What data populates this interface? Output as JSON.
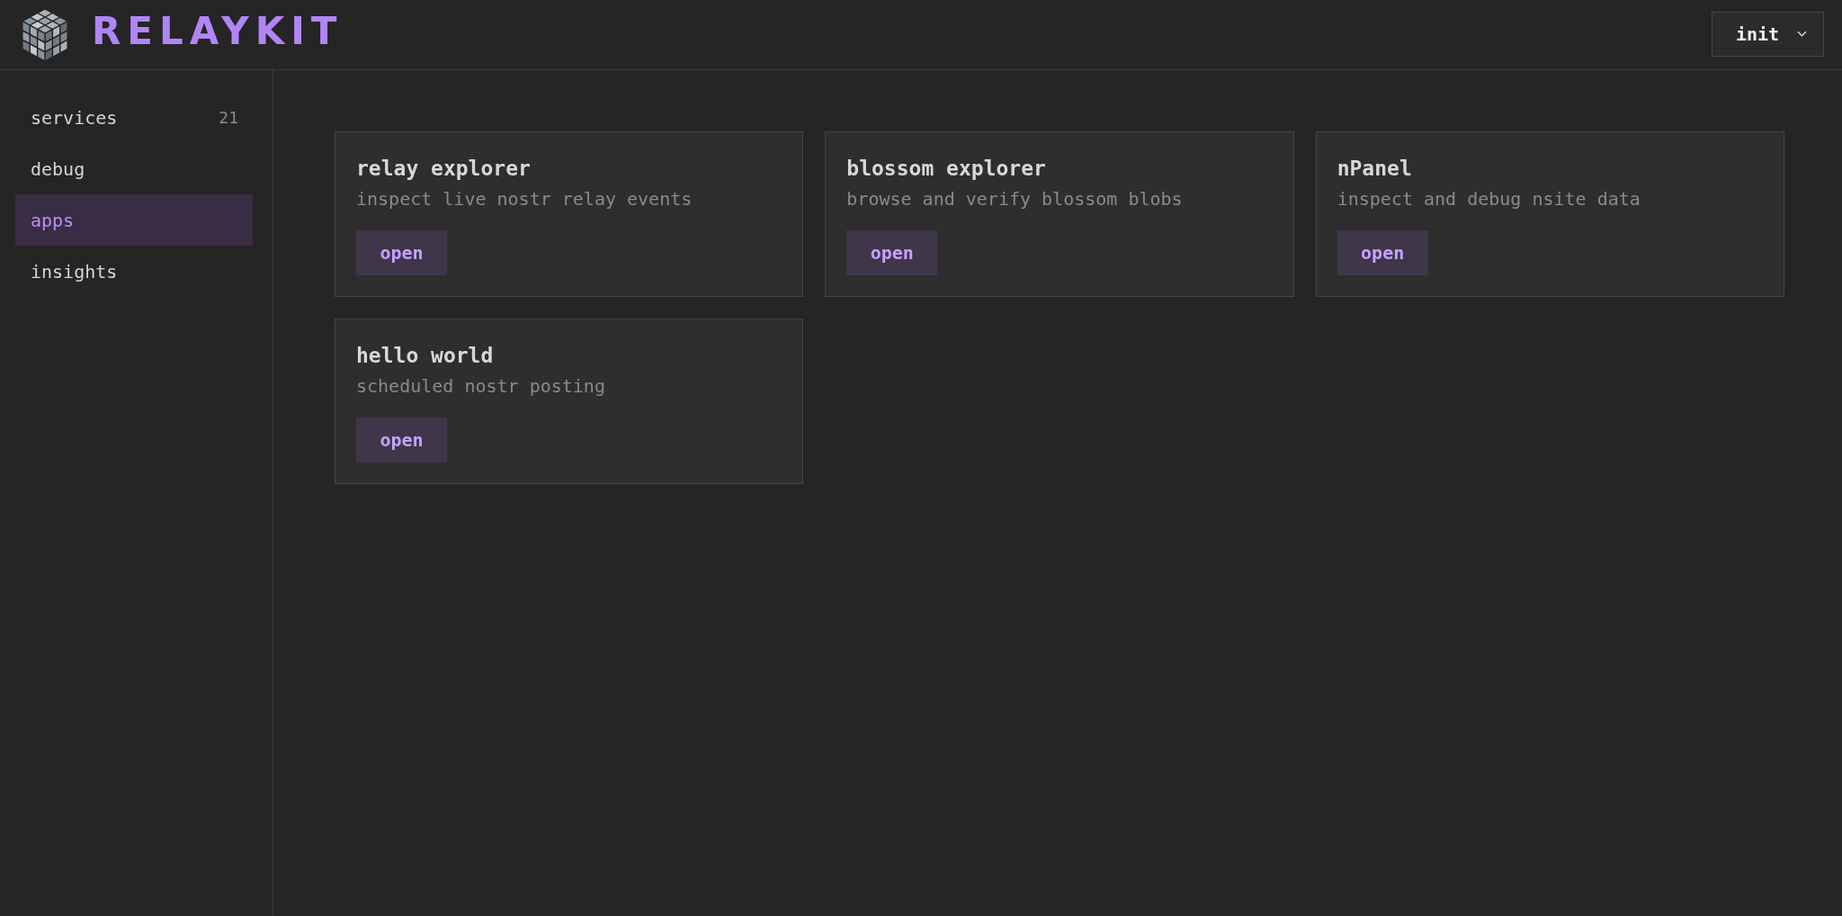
{
  "header": {
    "logo_text": "RELAYKIT",
    "dropdown": {
      "value": "init"
    }
  },
  "sidebar": {
    "items": [
      {
        "label": "services",
        "count": "21",
        "selected": false
      },
      {
        "label": "debug",
        "selected": false
      },
      {
        "label": "apps",
        "selected": true
      },
      {
        "label": "insights",
        "selected": false
      }
    ]
  },
  "apps": [
    {
      "title": "relay explorer",
      "description": "inspect live nostr relay events",
      "button": "open"
    },
    {
      "title": "blossom explorer",
      "description": "browse and verify blossom blobs",
      "button": "open"
    },
    {
      "title": "nPanel",
      "description": "inspect and debug nsite data",
      "button": "open"
    },
    {
      "title": "hello world",
      "description": "scheduled nostr posting",
      "button": "open"
    }
  ]
}
